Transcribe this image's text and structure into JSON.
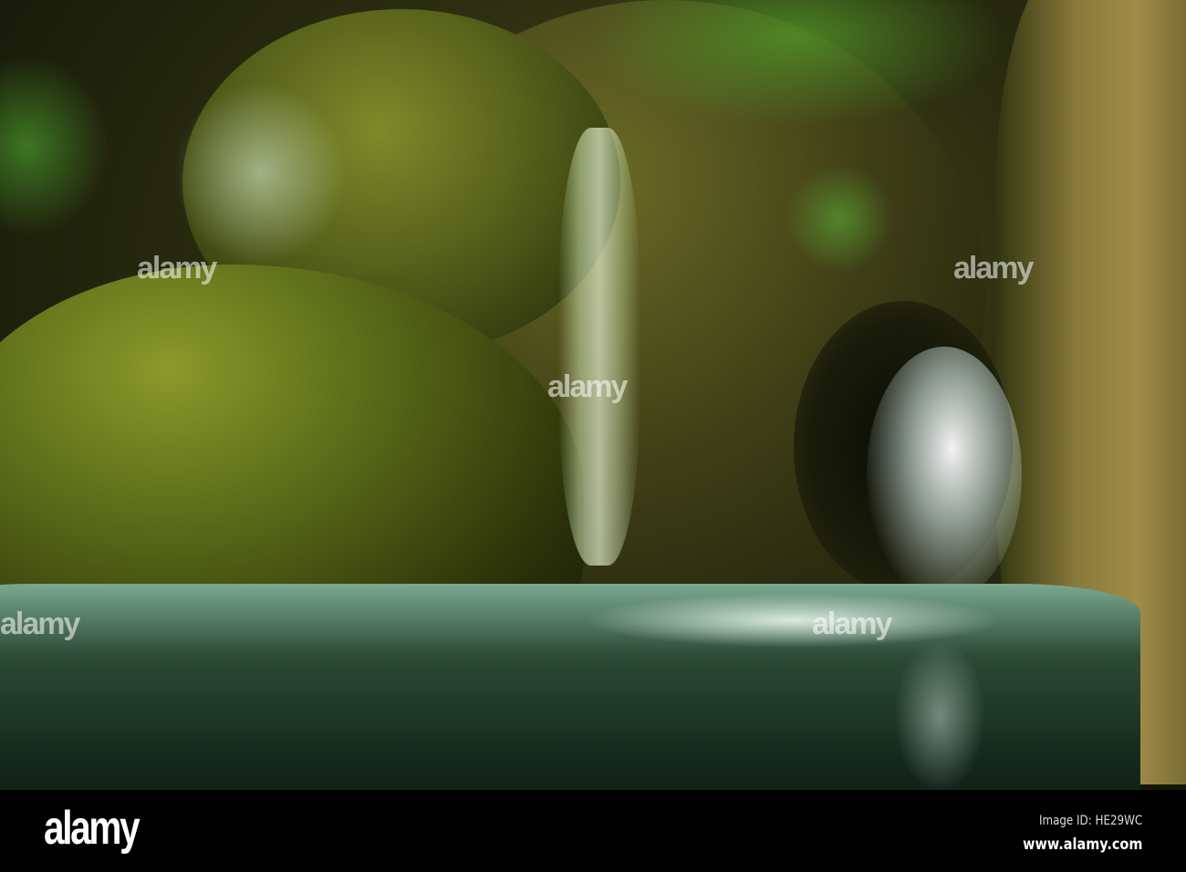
{
  "photo": {
    "subject": "waterfall",
    "watermark_text": "alamy"
  },
  "footer": {
    "logo": "alamy",
    "image_id": "Image ID: HE29WC",
    "url": "www.alamy.com"
  },
  "colors": {
    "moss": "#5a6a1a",
    "water": "#cfe8d8",
    "background": "#000000"
  }
}
